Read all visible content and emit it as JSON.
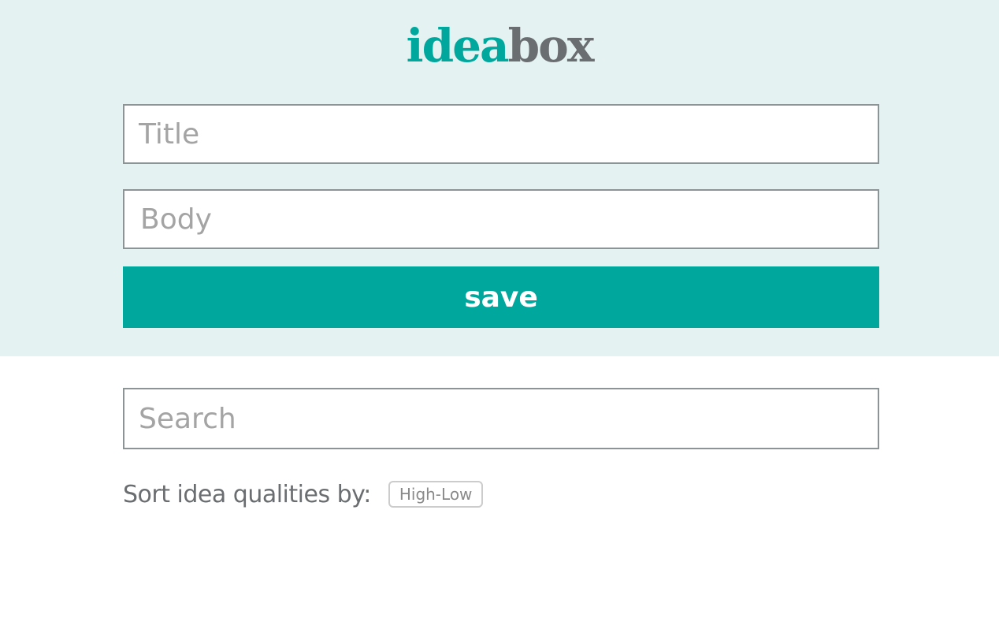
{
  "header": {
    "logo_part1": "idea",
    "logo_part2": "box"
  },
  "form": {
    "title_placeholder": "Title",
    "body_placeholder": "Body",
    "save_label": "save"
  },
  "search": {
    "placeholder": "Search"
  },
  "sort": {
    "label": "Sort idea qualities by:",
    "button_label": "High-Low"
  },
  "colors": {
    "accent": "#00a79d",
    "header_bg": "#e4f2f2",
    "logo_gray": "#6b6e70",
    "border": "#8c9496"
  }
}
